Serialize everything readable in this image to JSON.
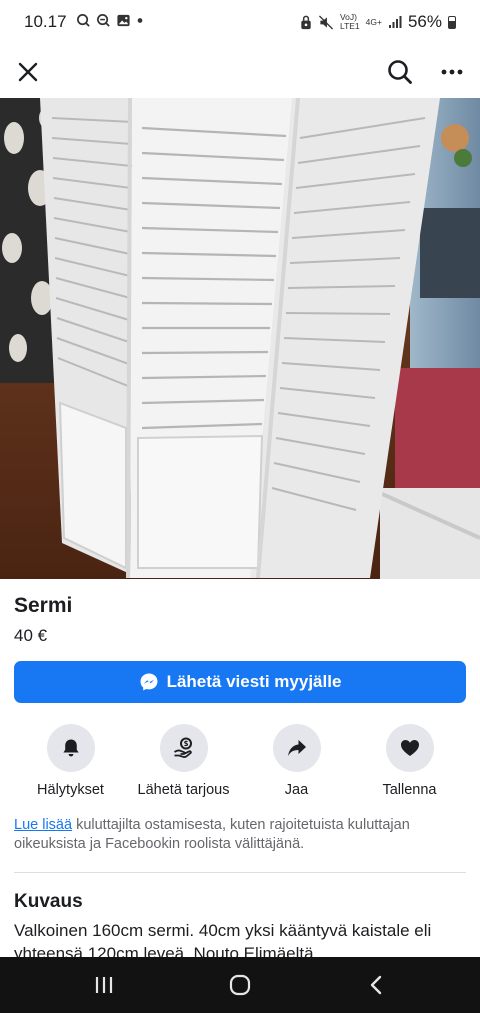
{
  "status_bar": {
    "time": "10.17",
    "network_top": "VoJ)",
    "network_bottom": "LTE1",
    "generation": "4G+",
    "battery": "56%"
  },
  "listing": {
    "title": "Sermi",
    "price": "40 €"
  },
  "message_button": {
    "label": "Lähetä viesti myyjälle",
    "icon": "messenger-icon"
  },
  "actions": [
    {
      "label": "Hälytykset",
      "icon": "bell-icon"
    },
    {
      "label": "Lähetä tarjous",
      "icon": "offer-icon"
    },
    {
      "label": "Jaa",
      "icon": "share-icon"
    },
    {
      "label": "Tallenna",
      "icon": "heart-icon"
    }
  ],
  "info": {
    "link_text": "Lue lisää",
    "text": " kuluttajilta ostamisesta, kuten rajoitetuista kuluttajan oikeuksista ja Facebookin roolista välittäjänä."
  },
  "description": {
    "heading": "Kuvaus",
    "text": "Valkoinen 160cm sermi. 40cm yksi kääntyvä kaistale eli yhteensä 120cm leveä. Nouto Elimäeltä."
  },
  "colors": {
    "accent": "#1877f2",
    "action_circle": "#e4e6eb",
    "nav_bar": "#121212"
  }
}
